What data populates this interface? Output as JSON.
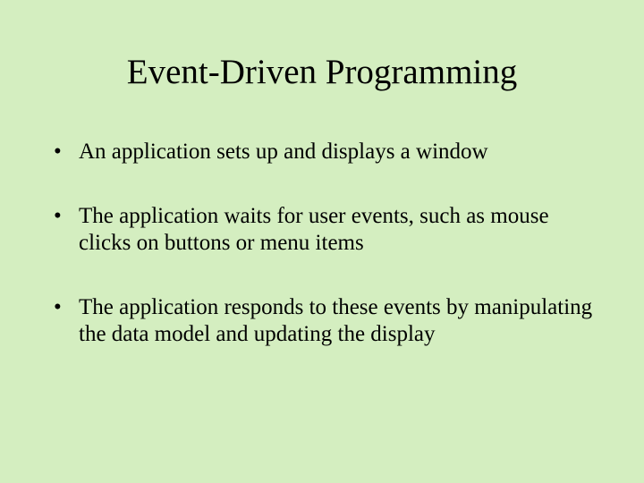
{
  "slide": {
    "title": "Event-Driven Programming",
    "bullets": [
      "An application sets up and displays a window",
      "The application waits for user events, such as mouse clicks on buttons or menu items",
      "The application responds to these events by manipulating the data model and updating the display"
    ]
  }
}
